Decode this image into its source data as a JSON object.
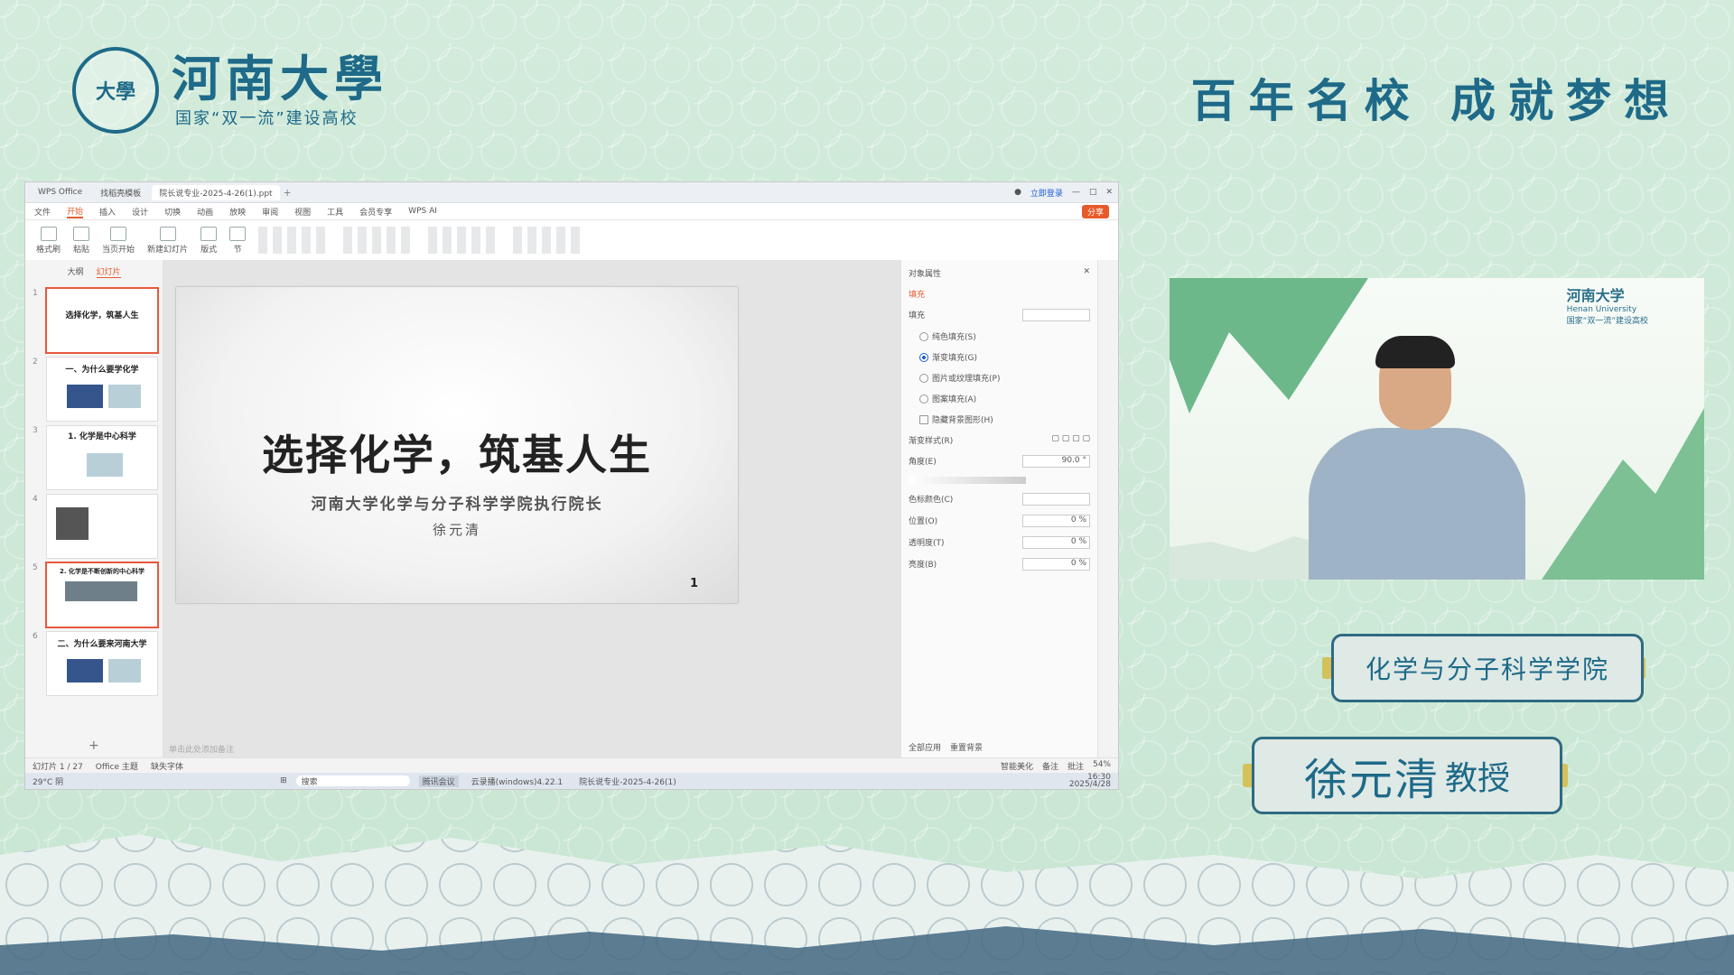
{
  "brand": {
    "seal_text": "大學",
    "name": "河南大學",
    "subtitle": "国家“双一流”建设高校",
    "slogan": "百年名校  成就梦想"
  },
  "wps": {
    "tabs": [
      "WPS Office",
      "找稻壳模板",
      "院长说专业-2025-4-26(1).ppt"
    ],
    "login": "立即登录",
    "menu": [
      "文件",
      "开始",
      "插入",
      "设计",
      "切换",
      "动画",
      "放映",
      "审阅",
      "视图",
      "工具",
      "会员专享",
      "WPS AI"
    ],
    "share": "分享",
    "ribbon": [
      "格式刷",
      "粘贴",
      "当页开始",
      "新建幻灯片",
      "版式",
      "节"
    ],
    "thumb_tabs": [
      "大纲",
      "幻灯片"
    ],
    "thumbs": [
      {
        "n": "1",
        "title": "选择化学，筑基人生"
      },
      {
        "n": "2",
        "title": "一、为什么要学化学"
      },
      {
        "n": "3",
        "title": "1. 化学是中心科学"
      },
      {
        "n": "4",
        "title": ""
      },
      {
        "n": "5",
        "title": "2. 化学是不断创新的中心科学"
      },
      {
        "n": "6",
        "title": "二、为什么要来河南大学"
      }
    ],
    "slide": {
      "title": "选择化学，筑基人生",
      "subtitle": "河南大学化学与分子科学学院执行院长",
      "author": "徐元清",
      "page": "1"
    },
    "note_placeholder": "单击此处添加备注",
    "prop": {
      "header": "对象属性",
      "fill_tab": "填充",
      "fill_label": "填充",
      "options": [
        "纯色填充(S)",
        "渐变填充(G)",
        "图片或纹理填充(P)",
        "图案填充(A)",
        "隐藏背景图形(H)"
      ],
      "gradient_style": "渐变样式(R)",
      "angle_label": "角度(E)",
      "angle_value": "90.0 °",
      "color_label": "色标颜色(C)",
      "position_label": "位置(O)",
      "position_value": "0 %",
      "transparency_label": "透明度(T)",
      "transparency_value": "0 %",
      "brightness_label": "亮度(B)",
      "brightness_value": "0 %",
      "apply_all": "全部应用",
      "reset": "重置背景"
    },
    "status": {
      "slide_count": "幻灯片 1 / 27",
      "theme": "Office 主题",
      "font_missing": "缺失字体",
      "beautify": "智能美化",
      "notes": "备注",
      "comments": "批注",
      "zoom": "54%"
    },
    "taskbar": {
      "weather": "29°C 阴",
      "search": "搜索",
      "apps": [
        "腾讯会议",
        "云录播(windows)4.22.1",
        "院长说专业-2025-4-26(1)"
      ],
      "time": "16:30",
      "date": "2025/4/28"
    }
  },
  "video": {
    "logo_name": "河南大学",
    "logo_en": "Henan University",
    "logo_sub": "国家“双一流”建设高校"
  },
  "badges": {
    "college": "化学与分子科学学院",
    "name": "徐元清",
    "title": "教授"
  }
}
